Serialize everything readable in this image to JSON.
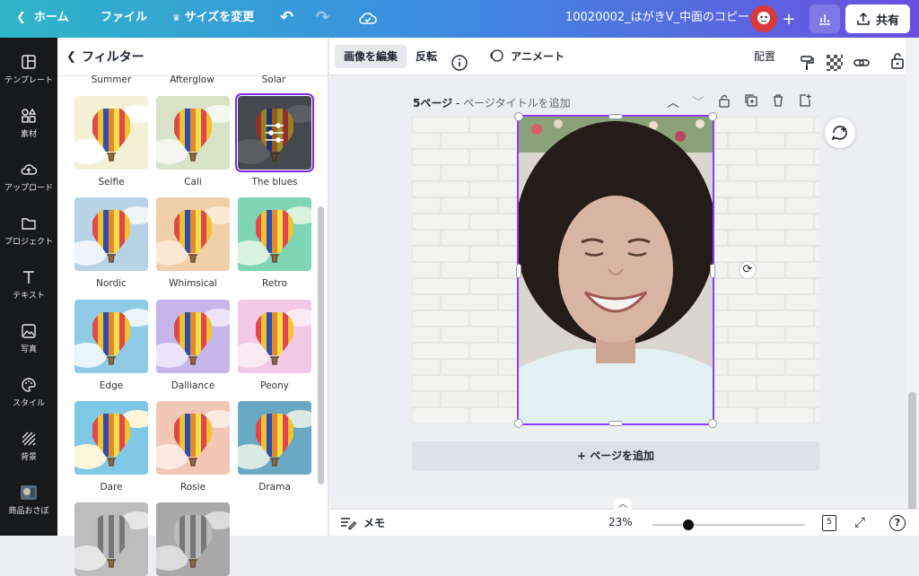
{
  "topbar": {
    "home": "ホーム",
    "file": "ファイル",
    "resize": "サイズを変更",
    "doc_title": "10020002_はがきV_中面のコピー",
    "share": "共有"
  },
  "rail": [
    {
      "label": "テンプレート",
      "icon": "template-icon"
    },
    {
      "label": "素材",
      "icon": "elements-icon"
    },
    {
      "label": "アップロード",
      "icon": "upload-icon"
    },
    {
      "label": "プロジェクト",
      "icon": "folder-icon"
    },
    {
      "label": "テキスト",
      "icon": "text-icon"
    },
    {
      "label": "写真",
      "icon": "photo-icon"
    },
    {
      "label": "スタイル",
      "icon": "palette-icon"
    },
    {
      "label": "背景",
      "icon": "background-icon"
    },
    {
      "label": "商品おさぼ",
      "icon": "product-icon"
    }
  ],
  "panel": {
    "title": "フィルター",
    "top_labels": [
      "Summer",
      "Afterglow",
      "Solar"
    ]
  },
  "filters": [
    {
      "name": "Selfie",
      "sky": "#f4f1d6",
      "cloud": "#ffffff"
    },
    {
      "name": "Cali",
      "sky": "#d9e3c8",
      "cloud": "#f5f6ee"
    },
    {
      "name": "The blues",
      "sky": "#6b7077",
      "cloud": "#8a8f95",
      "selected": true
    },
    {
      "name": "Nordic",
      "sky": "#b8d2e6",
      "cloud": "#eef4fa"
    },
    {
      "name": "Whimsical",
      "sky": "#f1cfa8",
      "cloud": "#fbe9d4"
    },
    {
      "name": "Retro",
      "sky": "#7fd6b7",
      "cloud": "#d8f3e0"
    },
    {
      "name": "Edge",
      "sky": "#8fcbe4",
      "cloud": "#e8f6fb"
    },
    {
      "name": "Dalliance",
      "sky": "#c7b6ea",
      "cloud": "#ece4fa"
    },
    {
      "name": "Peony",
      "sky": "#f4c9e6",
      "cloud": "#fbe9f4"
    },
    {
      "name": "Dare",
      "sky": "#7fc8e6",
      "cloud": "#fdf6d8"
    },
    {
      "name": "Rosie",
      "sky": "#f3c7b6",
      "cloud": "#fbe9e2"
    },
    {
      "name": "Drama",
      "sky": "#6aa9c4",
      "cloud": "#dbe9e4"
    },
    {
      "name": "",
      "sky": "#bdbdbd",
      "cloud": "#e6e6e6"
    },
    {
      "name": "",
      "sky": "#a9a9a9",
      "cloud": "#dcdcdc"
    }
  ],
  "toolbar": {
    "edit_image": "画像を編集",
    "flip": "反転",
    "animate": "アニメート",
    "position": "配置"
  },
  "page": {
    "label": "5ページ",
    "sep": " - ",
    "title_placeholder": "ページタイトルを追加",
    "add_page": "+ ページを追加"
  },
  "bottom": {
    "notes": "メモ",
    "zoom": "23%",
    "zoom_level": 0.23,
    "page_count": "5"
  },
  "colors": {
    "accent": "#7d2ae8",
    "selection": "#8b3dff"
  }
}
